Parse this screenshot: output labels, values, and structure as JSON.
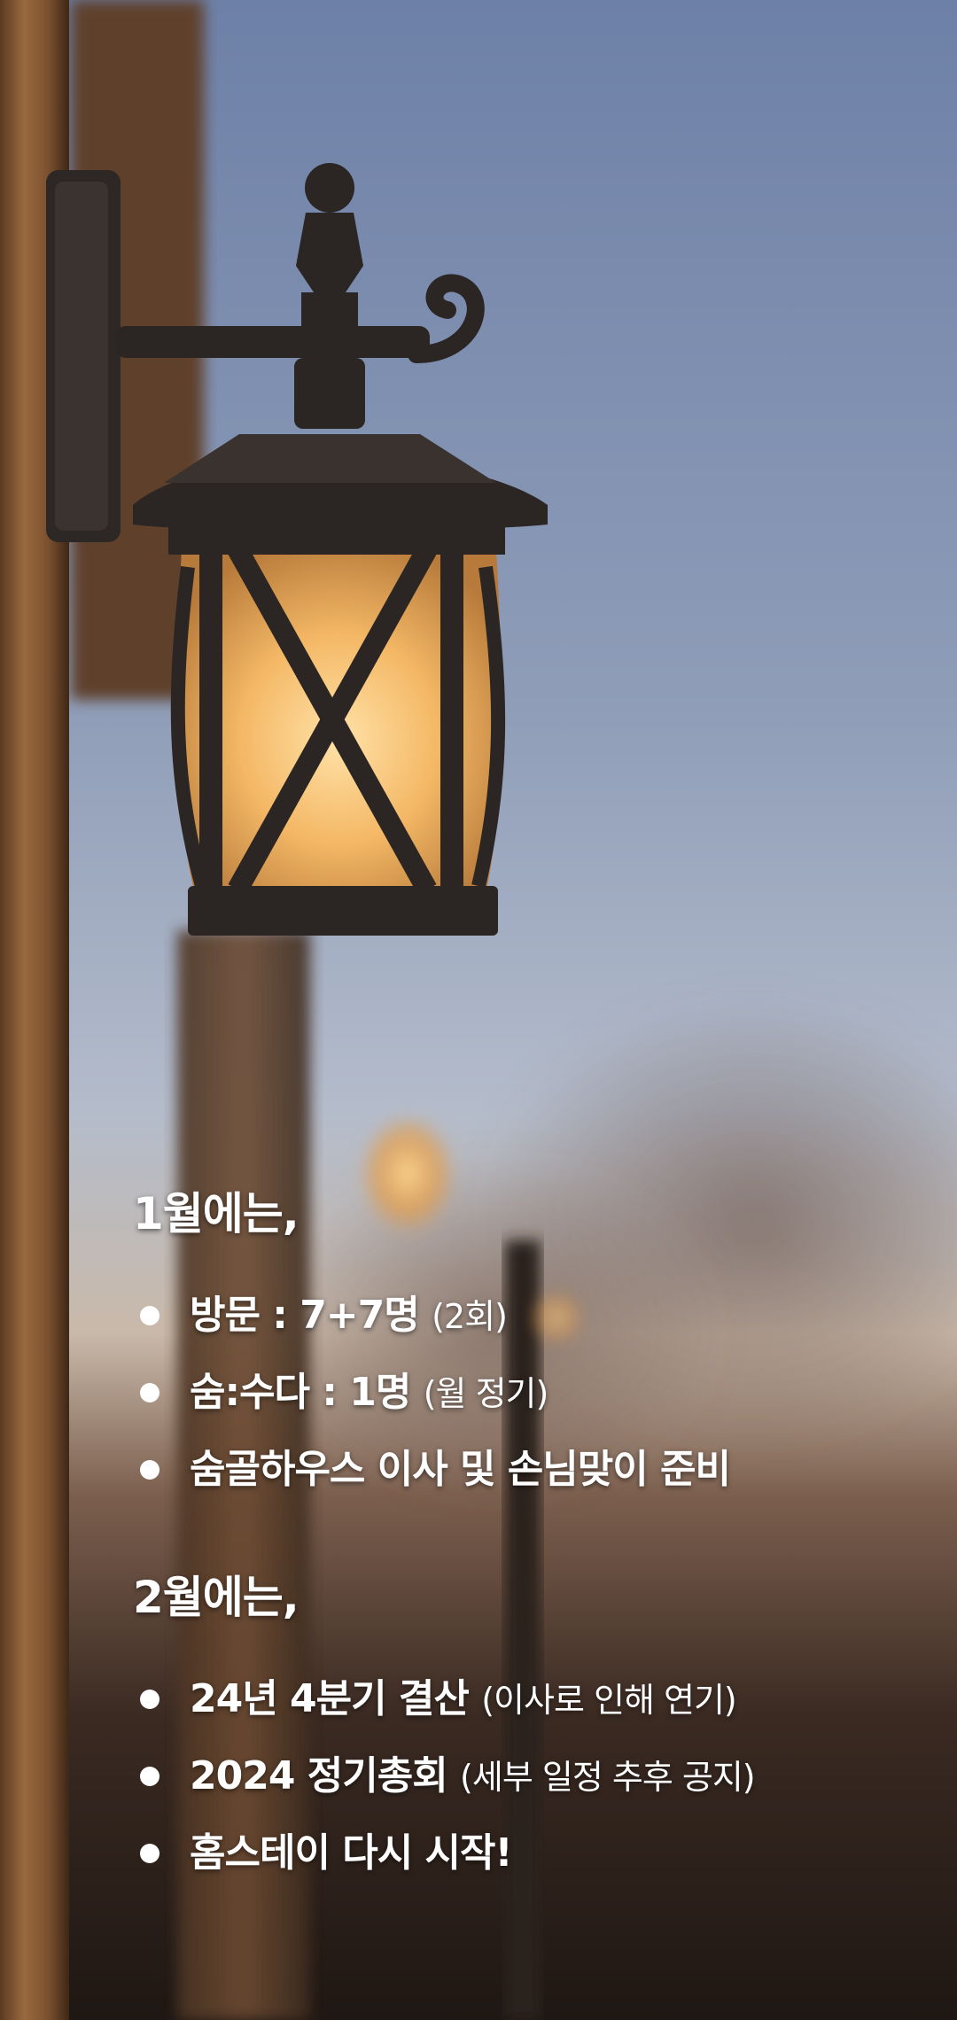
{
  "background": {
    "description_icon": "wall-lantern-photo",
    "colors": {
      "sky_top": "#6f82a8",
      "sky_mid": "#a9b4c6",
      "horizon": "#c6b2a2",
      "ground": "#2a1f1a",
      "post": "#8a5a32",
      "lantern_glow": "#f7c779",
      "iron": "#2b2523"
    }
  },
  "sections": [
    {
      "title": "1월에는,",
      "items": [
        {
          "main": "방문 : 7+7명",
          "note": "(2회)"
        },
        {
          "main": "숨:수다 : 1명",
          "note": "(월 정기)"
        },
        {
          "main": "숨골하우스 이사 및 손님맞이 준비",
          "note": ""
        }
      ]
    },
    {
      "title": "2월에는,",
      "items": [
        {
          "main": "24년 4분기 결산",
          "note": "(이사로 인해 연기)"
        },
        {
          "main": "2024 정기총회",
          "note": "(세부 일정 추후 공지)"
        },
        {
          "main": "홈스테이 다시 시작!",
          "note": ""
        }
      ]
    }
  ]
}
